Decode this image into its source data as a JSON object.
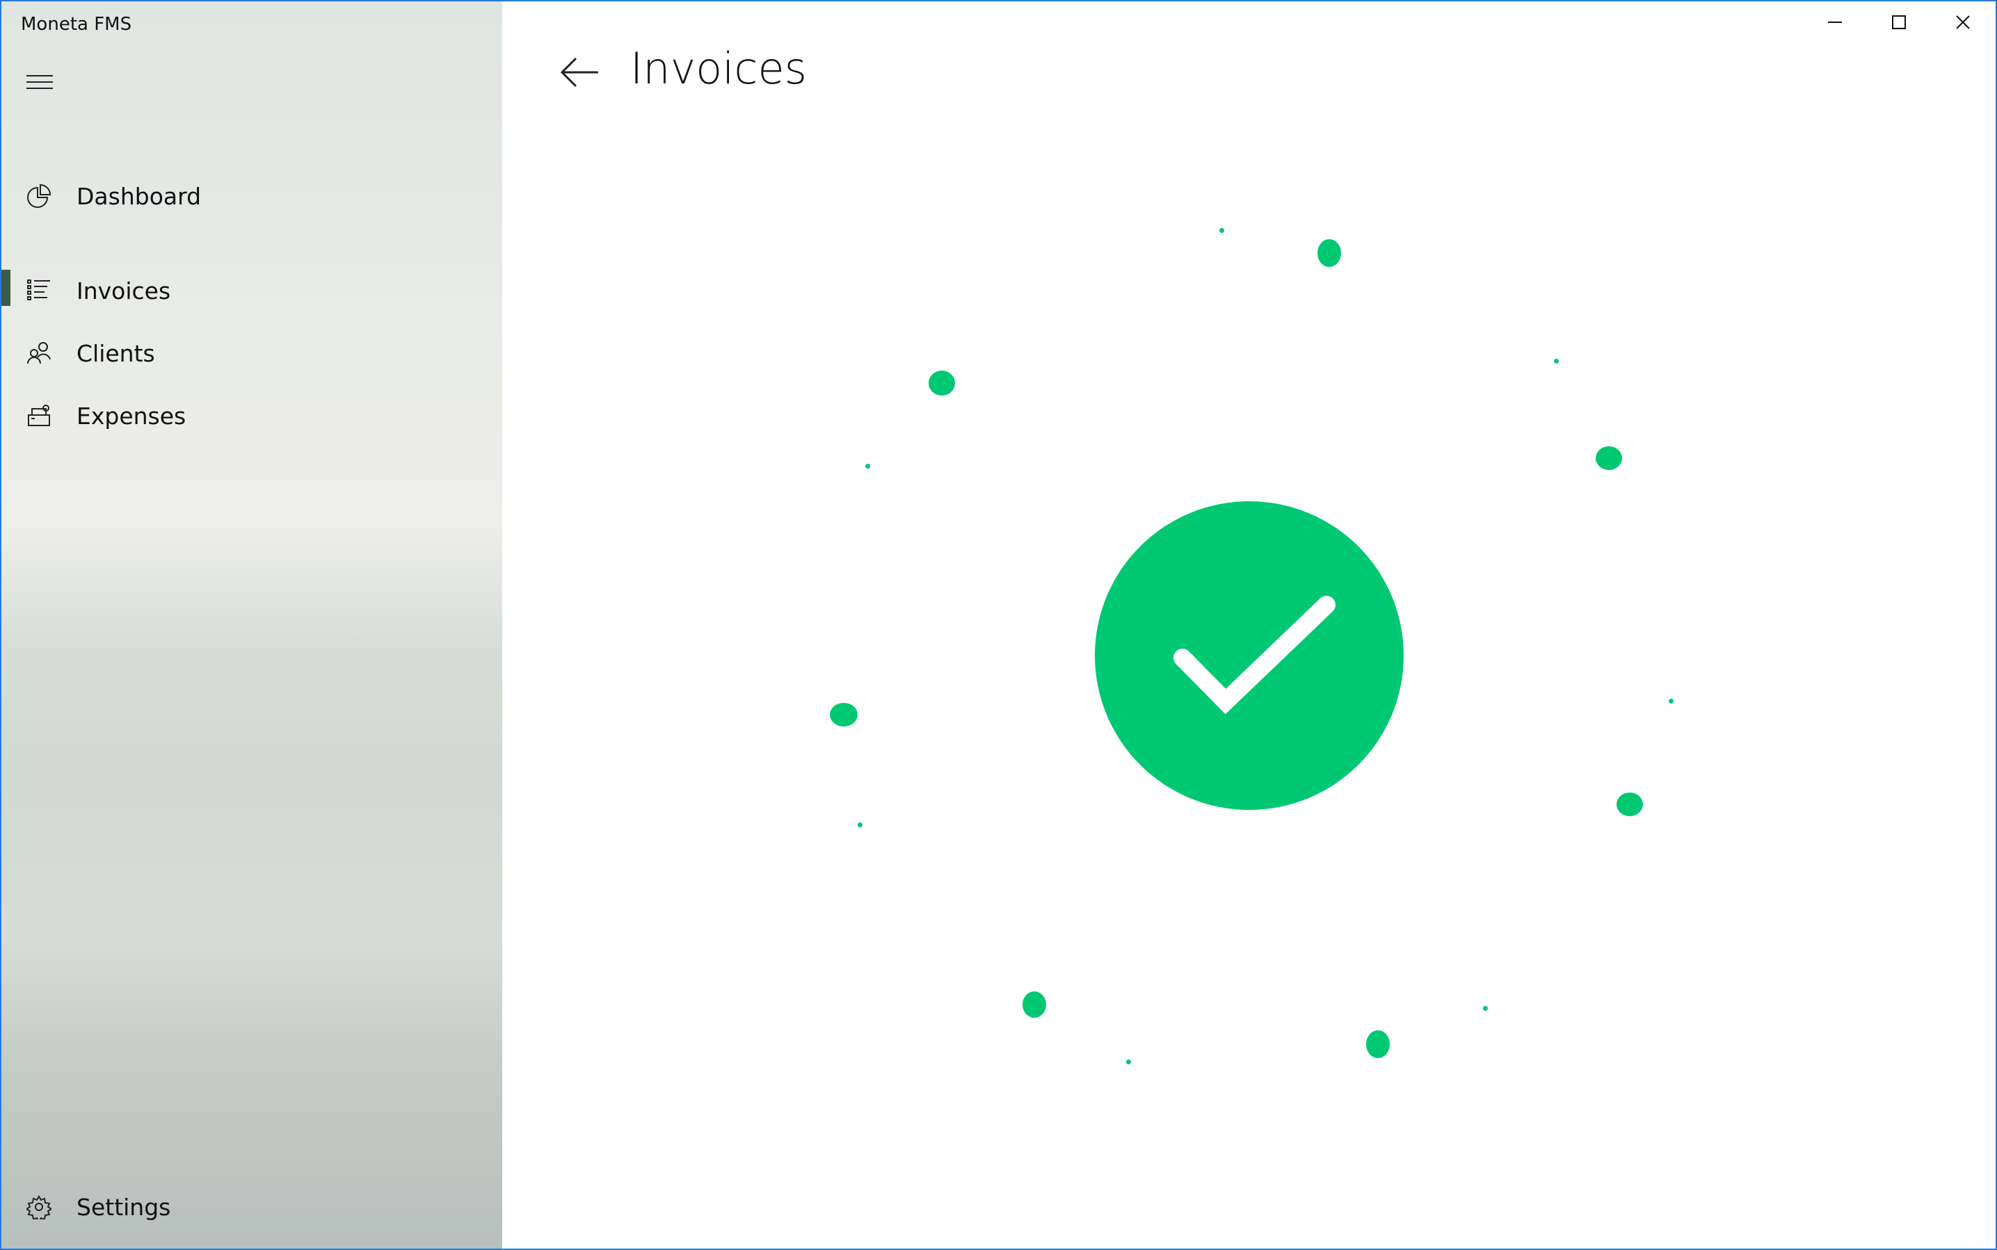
{
  "window": {
    "title": "Moneta FMS",
    "controls": [
      "minimize",
      "maximize",
      "close"
    ]
  },
  "sidebar": {
    "menu_icon": "hamburger-icon",
    "items": [
      {
        "label": "Dashboard",
        "icon": "pie-chart-icon",
        "selected": false
      },
      {
        "label": "Invoices",
        "icon": "bulleted-list-icon",
        "selected": true
      },
      {
        "label": "Clients",
        "icon": "people-icon",
        "selected": false
      },
      {
        "label": "Expenses",
        "icon": "cash-register-icon",
        "selected": false
      }
    ],
    "settings": {
      "label": "Settings",
      "icon": "gear-icon"
    }
  },
  "header": {
    "title": "Invoices",
    "back_icon": "back-arrow-icon"
  },
  "main": {
    "status_icon": "success-checkmark-icon",
    "accent_color": "#00c872"
  }
}
